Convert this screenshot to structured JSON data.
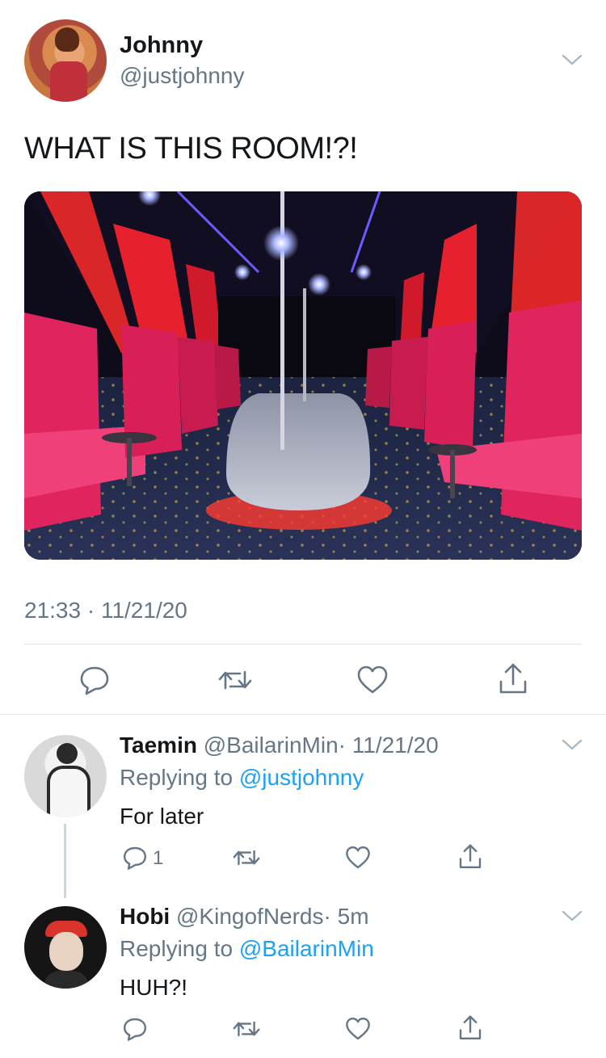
{
  "main_tweet": {
    "author": {
      "name": "Johnny",
      "handle": "@justjohnny"
    },
    "text": "WHAT IS THIS ROOM!?!",
    "timestamp": "21:33 · 11/21/20",
    "actions": [
      "reply-icon",
      "retweet-icon",
      "like-icon",
      "share-icon"
    ]
  },
  "replies": [
    {
      "name": "Taemin",
      "handle": "@BailarinMin",
      "time": "· 11/21/20",
      "replying_prefix": "Replying to",
      "replying_to": "@justjohnny",
      "text": "For later",
      "reply_count": "1"
    },
    {
      "name": "Hobi",
      "handle": "@KingofNerds",
      "time": "· 5m",
      "replying_prefix": "Replying to",
      "replying_to": "@BailarinMin",
      "text": "HUH?!",
      "reply_count": ""
    }
  ],
  "colors": {
    "accent": "#1da1f2",
    "secondary_text": "#657786",
    "divider": "#e1e8ed",
    "primary_text": "#14171a"
  }
}
